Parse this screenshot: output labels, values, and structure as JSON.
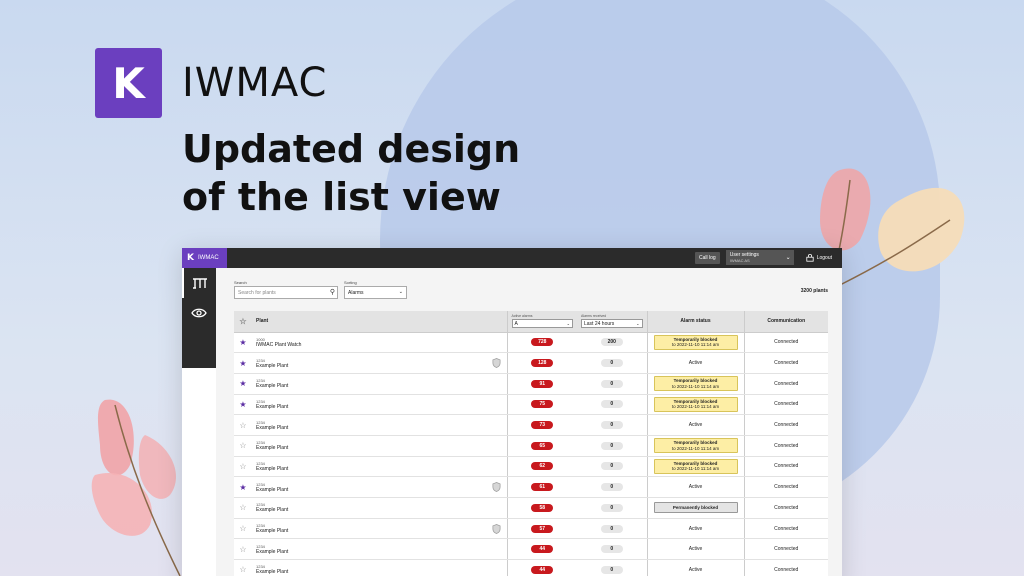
{
  "brand": {
    "logo_letter": "K",
    "name": "IWMAC"
  },
  "headline": {
    "line1": "Updated design",
    "line2": "of the list view"
  },
  "app": {
    "topbar": {
      "brand_letter": "K",
      "brand_name": "IWMAC",
      "call_log": "Call log",
      "user_settings": "User settings",
      "user_settings_sub": "IWMAC AS",
      "logout": "Logout"
    },
    "toolbar": {
      "search_label": "Search",
      "search_placeholder": "Search for plants",
      "sorting_label": "Sorting",
      "sorting_value": "Alarms"
    },
    "plant_count": "3200 plants",
    "columns": {
      "plant": "Plant",
      "active_alarms_label": "Active alarms",
      "active_alarms_value": "A",
      "alarms_received_label": "Alarms received",
      "alarms_received_value": "Last 24 hours",
      "alarm_status": "Alarm status",
      "communication": "Communication"
    },
    "rows": [
      {
        "starred": true,
        "id": "1000",
        "name": "IWMAC Plant Watch",
        "shield": false,
        "alarms": "728",
        "received": "200",
        "status": "blocked",
        "status_text": "Temporarily blocked",
        "status_sub": "to 2022-11-10 11:14 am",
        "comm": "Connected"
      },
      {
        "starred": true,
        "id": "1234",
        "name": "Example Plant",
        "shield": true,
        "alarms": "128",
        "received": "0",
        "status": "active",
        "status_text": "Active",
        "status_sub": "",
        "comm": "Connected"
      },
      {
        "starred": true,
        "id": "1234",
        "name": "Example Plant",
        "shield": false,
        "alarms": "91",
        "received": "0",
        "status": "blocked",
        "status_text": "Temporarily blocked",
        "status_sub": "to 2022-11-10 11:14 am",
        "comm": "Connected"
      },
      {
        "starred": true,
        "id": "1234",
        "name": "Example Plant",
        "shield": false,
        "alarms": "75",
        "received": "0",
        "status": "blocked",
        "status_text": "Temporarily blocked",
        "status_sub": "to 2022-11-10 11:14 am",
        "comm": "Connected"
      },
      {
        "starred": false,
        "id": "1234",
        "name": "Example Plant",
        "shield": false,
        "alarms": "73",
        "received": "0",
        "status": "active",
        "status_text": "Active",
        "status_sub": "",
        "comm": "Connected"
      },
      {
        "starred": false,
        "id": "1234",
        "name": "Example Plant",
        "shield": false,
        "alarms": "65",
        "received": "0",
        "status": "blocked",
        "status_text": "Temporarily blocked",
        "status_sub": "to 2022-11-10 11:14 am",
        "comm": "Connected"
      },
      {
        "starred": false,
        "id": "1234",
        "name": "Example Plant",
        "shield": false,
        "alarms": "62",
        "received": "0",
        "status": "blocked",
        "status_text": "Temporarily blocked",
        "status_sub": "to 2022-11-10 11:14 am",
        "comm": "Connected"
      },
      {
        "starred": true,
        "id": "1234",
        "name": "Example Plant",
        "shield": true,
        "alarms": "61",
        "received": "0",
        "status": "active",
        "status_text": "Active",
        "status_sub": "",
        "comm": "Connected"
      },
      {
        "starred": false,
        "id": "1234",
        "name": "Example Plant",
        "shield": false,
        "alarms": "58",
        "received": "0",
        "status": "permanent",
        "status_text": "Permanently blocked",
        "status_sub": "",
        "comm": "Connected"
      },
      {
        "starred": false,
        "id": "1234",
        "name": "Example Plant",
        "shield": true,
        "alarms": "57",
        "received": "0",
        "status": "active",
        "status_text": "Active",
        "status_sub": "",
        "comm": "Connected"
      },
      {
        "starred": false,
        "id": "1234",
        "name": "Example Plant",
        "shield": false,
        "alarms": "44",
        "received": "0",
        "status": "active",
        "status_text": "Active",
        "status_sub": "",
        "comm": "Connected"
      },
      {
        "starred": false,
        "id": "1234",
        "name": "Example Plant",
        "shield": false,
        "alarms": "44",
        "received": "0",
        "status": "active",
        "status_text": "Active",
        "status_sub": "",
        "comm": "Connected"
      }
    ]
  },
  "colors": {
    "brand_purple": "#6b3fbf",
    "alarm_red": "#c8191e",
    "blocked_yellow": "#fdeea5"
  }
}
